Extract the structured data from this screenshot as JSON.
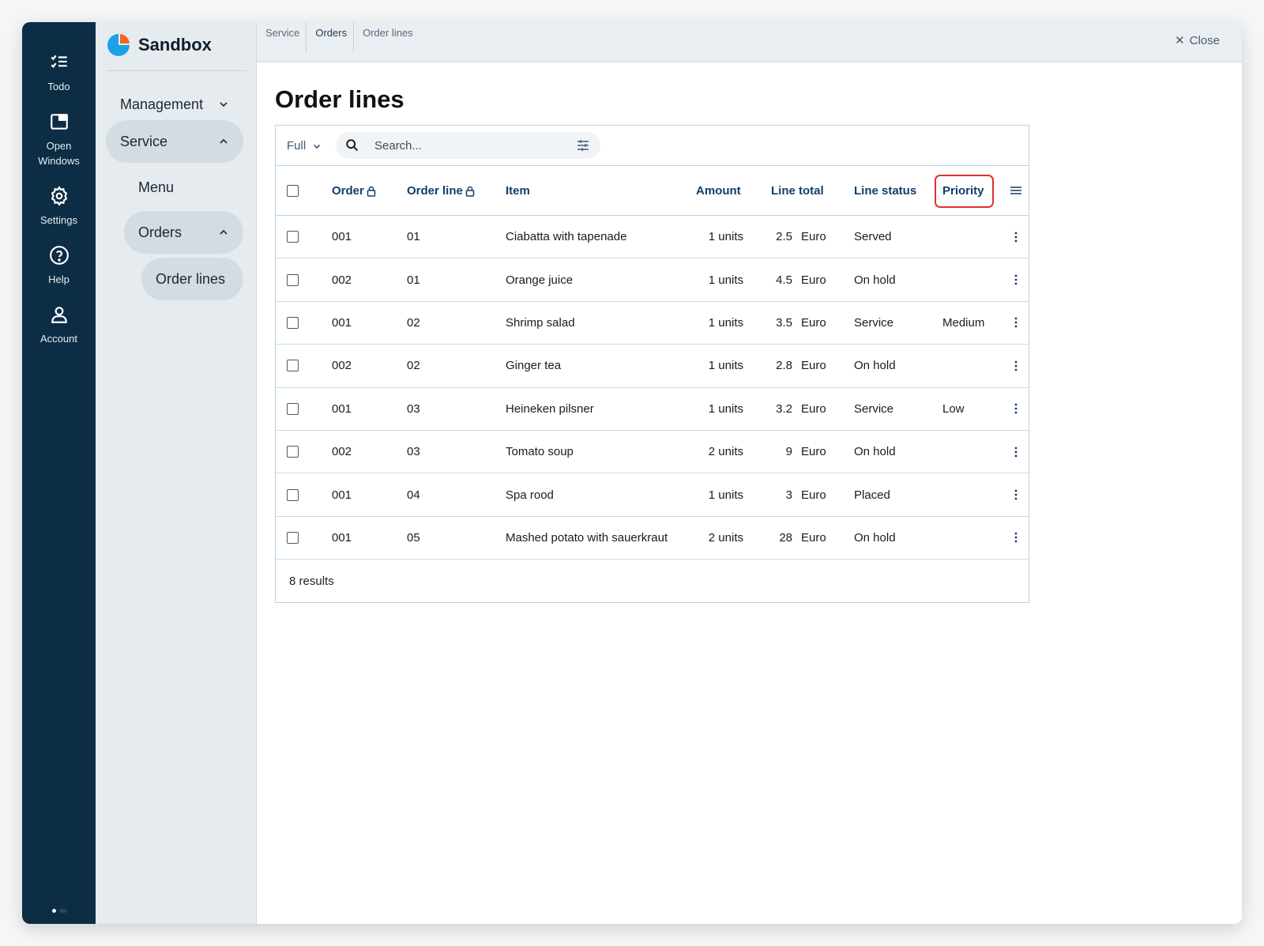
{
  "rail": {
    "items": [
      {
        "label": "Todo",
        "icon": "todo-checklist-icon"
      },
      {
        "label": "Open Windows",
        "icon": "open-windows-icon"
      },
      {
        "label": "Settings",
        "icon": "gear-icon"
      },
      {
        "label": "Help",
        "icon": "help-circle-icon"
      },
      {
        "label": "Account",
        "icon": "user-icon"
      }
    ]
  },
  "nav": {
    "brand": "Sandbox",
    "items": [
      {
        "label": "Management"
      },
      {
        "label": "Service"
      },
      {
        "label": "Menu"
      },
      {
        "label": "Orders"
      },
      {
        "label": "Order lines"
      }
    ]
  },
  "breadcrumb": [
    "Service",
    "Orders",
    "Order lines"
  ],
  "close_label": "Close",
  "page_title": "Order lines",
  "toolbar": {
    "view": "Full",
    "search_placeholder": "Search..."
  },
  "table": {
    "columns": [
      "Order",
      "Order line",
      "Item",
      "Amount",
      "Line total",
      "Line status",
      "Priority"
    ],
    "rows": [
      {
        "order": "001",
        "line": "01",
        "item": "Ciabatta with tapenade",
        "amount": "1 units",
        "total": "2.5",
        "currency": "Euro",
        "status": "Served",
        "priority": ""
      },
      {
        "order": "002",
        "line": "01",
        "item": "Orange juice",
        "amount": "1 units",
        "total": "4.5",
        "currency": "Euro",
        "status": "On hold",
        "priority": ""
      },
      {
        "order": "001",
        "line": "02",
        "item": "Shrimp salad",
        "amount": "1 units",
        "total": "3.5",
        "currency": "Euro",
        "status": "Service",
        "priority": "Medium"
      },
      {
        "order": "002",
        "line": "02",
        "item": "Ginger tea",
        "amount": "1 units",
        "total": "2.8",
        "currency": "Euro",
        "status": "On hold",
        "priority": ""
      },
      {
        "order": "001",
        "line": "03",
        "item": "Heineken pilsner",
        "amount": "1 units",
        "total": "3.2",
        "currency": "Euro",
        "status": "Service",
        "priority": "Low"
      },
      {
        "order": "002",
        "line": "03",
        "item": "Tomato soup",
        "amount": "2 units",
        "total": "9",
        "currency": "Euro",
        "status": "On hold",
        "priority": ""
      },
      {
        "order": "001",
        "line": "04",
        "item": "Spa rood",
        "amount": "1 units",
        "total": "3",
        "currency": "Euro",
        "status": "Placed",
        "priority": ""
      },
      {
        "order": "001",
        "line": "05",
        "item": "Mashed potato with sauerkraut",
        "amount": "2 units",
        "total": "28",
        "currency": "Euro",
        "status": "On hold",
        "priority": ""
      }
    ],
    "result_count": "8 results"
  },
  "colors": {
    "rail_bg": "#0c2d44",
    "nav_bg": "#e6ebef",
    "header_text": "#123e6b",
    "highlight": "#e03131",
    "logo_blue": "#1aa3e8",
    "logo_orange": "#f26522"
  }
}
